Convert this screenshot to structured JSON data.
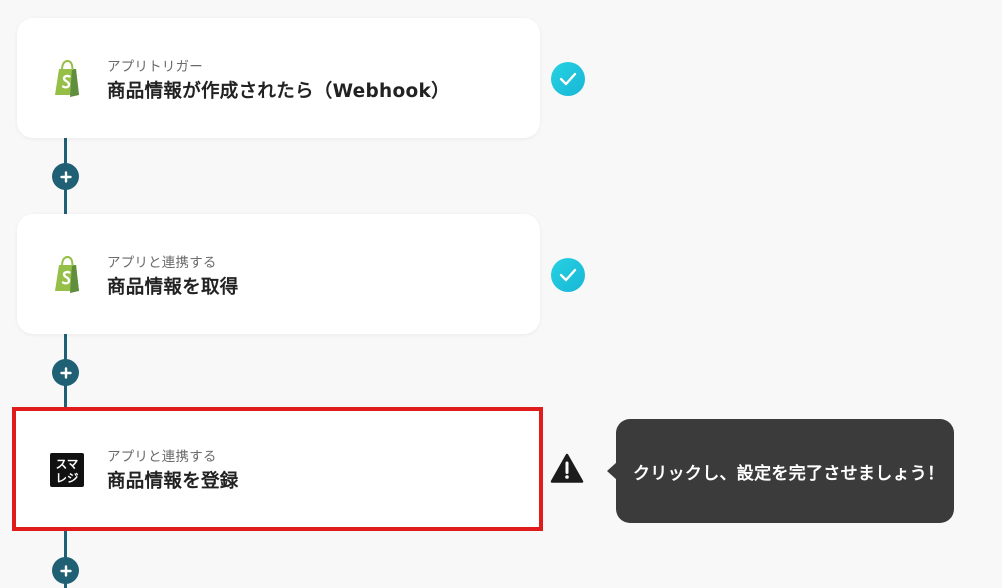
{
  "flow": {
    "steps": [
      {
        "subtitle": "アプリトリガー",
        "title": "商品情報が作成されたら（Webhook）",
        "app_icon": "shopify-icon",
        "status": "completed",
        "status_icon": "check-icon"
      },
      {
        "subtitle": "アプリと連携する",
        "title": "商品情報を取得",
        "app_icon": "shopify-icon",
        "status": "completed",
        "status_icon": "check-icon"
      },
      {
        "subtitle": "アプリと連携する",
        "title": "商品情報を登録",
        "app_icon": "smaregi-icon",
        "app_icon_text": "スマレジ",
        "status": "incomplete",
        "status_icon": "warning-icon"
      }
    ],
    "add_step_icon": "plus-icon"
  },
  "tooltip": {
    "text": "クリックし、設定を完了させましょう！"
  },
  "colors": {
    "background": "#f8f8f8",
    "connector": "#1f6075",
    "check_badge": "#1ec5dd",
    "highlight_border": "#e01b1b",
    "tooltip_background": "#3b3b3b",
    "shopify_green": "#95bf47"
  }
}
